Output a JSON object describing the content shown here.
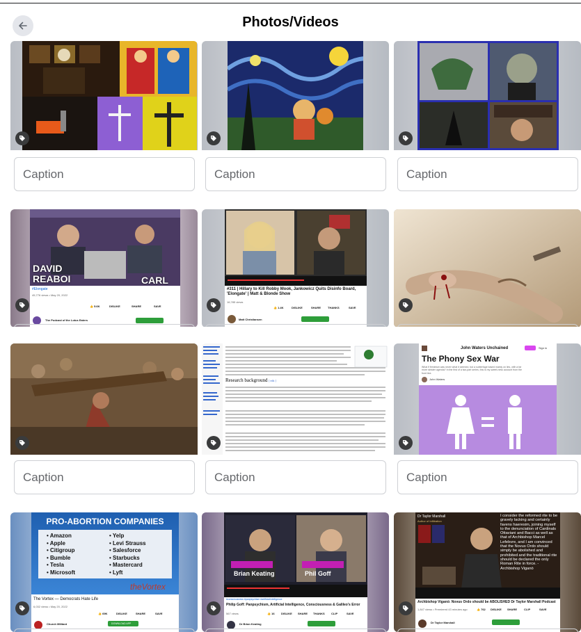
{
  "header": {
    "title": "Photos/Videos",
    "back_icon": "arrow-left-icon"
  },
  "caption_placeholder": "Caption",
  "tiles": [
    {
      "id": "t1",
      "caption": "Caption"
    },
    {
      "id": "t2",
      "caption": "Caption"
    },
    {
      "id": "t3",
      "caption": "Caption"
    },
    {
      "id": "t4",
      "caption": "",
      "overlay_name_left": "DAVID REABOI",
      "overlay_name_right": "CARL",
      "hashtag": "#Elongate",
      "meta": "45,776 views • May 20, 2022",
      "likes": "5.6K",
      "dislike": "DISLIKE",
      "share": "SHARE",
      "save": "SAVE",
      "channel": "The Podcast of the Lotus Eaters"
    },
    {
      "id": "t5",
      "caption": "",
      "video_title": "#311 | Hillary to Kill Robby Mook, Jankowicz Quits Disinfo Board, 'Elongate' | Matt & Blonde Show",
      "meta": "16,785 views",
      "likes": "1.4K",
      "dislike": "DISLIKE",
      "share": "SHARE",
      "thanks": "THANKS",
      "save": "SAVE",
      "channel": "Matt Christiansen"
    },
    {
      "id": "t6",
      "caption": ""
    },
    {
      "id": "t7",
      "caption": "Caption"
    },
    {
      "id": "t8",
      "caption": "Caption",
      "section_heading": "Research background",
      "edit_link": "edit"
    },
    {
      "id": "t9",
      "caption": "Caption",
      "site_name": "John Waters Unchained",
      "sign_in": "Sign in",
      "article_title": "The Phony Sex War",
      "article_sub": "What if feminism was never what it seemed, but a subterfuge based mainly on lies, with a far more sinister agenda? In the first of a two-part series, this is my sweet-ness account from the front line.",
      "author": "John Waters"
    },
    {
      "id": "t10",
      "caption": "",
      "slide_title": "PRO-ABORTION COMPANIES",
      "companies_left": [
        "Amazon",
        "Apple",
        "Citigroup",
        "Bumble",
        "Tesla",
        "Microsoft"
      ],
      "companies_right": [
        "Yelp",
        "Levi Strauss",
        "Salesforce",
        "Starbucks",
        "Mastercard",
        "Lyft"
      ],
      "brand": "theVortex",
      "video_title": "The Vortex — Democrats Hate Life",
      "meta": "6,032 views • May 20, 2022",
      "likes": "69K",
      "dislike": "DISLIKE",
      "share": "SHARE",
      "save": "SAVE",
      "channel": "Church Militant",
      "cta": "DOWNLOAD APP"
    },
    {
      "id": "t11",
      "caption": "",
      "name_left": "Brian Keating",
      "name_right": "Phil Goff",
      "hashtags": "#consciousness #panpsychism #artificialintelligence",
      "video_title": "Philip Goff: Panpsychism, Artificial Intelligence, Consciousness & Galileo's Error",
      "meta": "567 views",
      "likes": "16",
      "dislike": "DISLIKE",
      "share": "SHARE",
      "thanks": "THANKS",
      "clip": "CLIP",
      "save": "SAVE",
      "channel": "Dr Brian Keating"
    },
    {
      "id": "t12",
      "caption": "",
      "corner_label": "Dr Taylor Marshall",
      "corner_sub": "Author of Infiltration",
      "quote": "I consider the reformed rite to be gravely lacking and certainly favens haeresim, joining myself to the denunciation of Cardinals Ottaviani and Bacci as well as that of Archbishop Marcel Lefebvre, and I am convinced that the Novus Ordo should simply be abolished and prohibited and the traditional rite should be declared the only Roman Rite in force. - Archbishop Viganò",
      "video_title": "Archbishop Viganò: Novus Ordo should be ABOLISHED Dr Taylor Marshall Podcast",
      "meta": "1,847 views • Premiered 43 minutes ago",
      "likes": "762",
      "dislike": "DISLIKE",
      "share": "SHARE",
      "clip": "CLIP",
      "save": "SAVE",
      "channel": "Dr Taylor Marshall"
    }
  ],
  "colors": {
    "badge": "#3a3b3c",
    "caption_border": "#ced0d4",
    "caption_text": "#65676b",
    "back_btn": "#e4e6eb"
  }
}
